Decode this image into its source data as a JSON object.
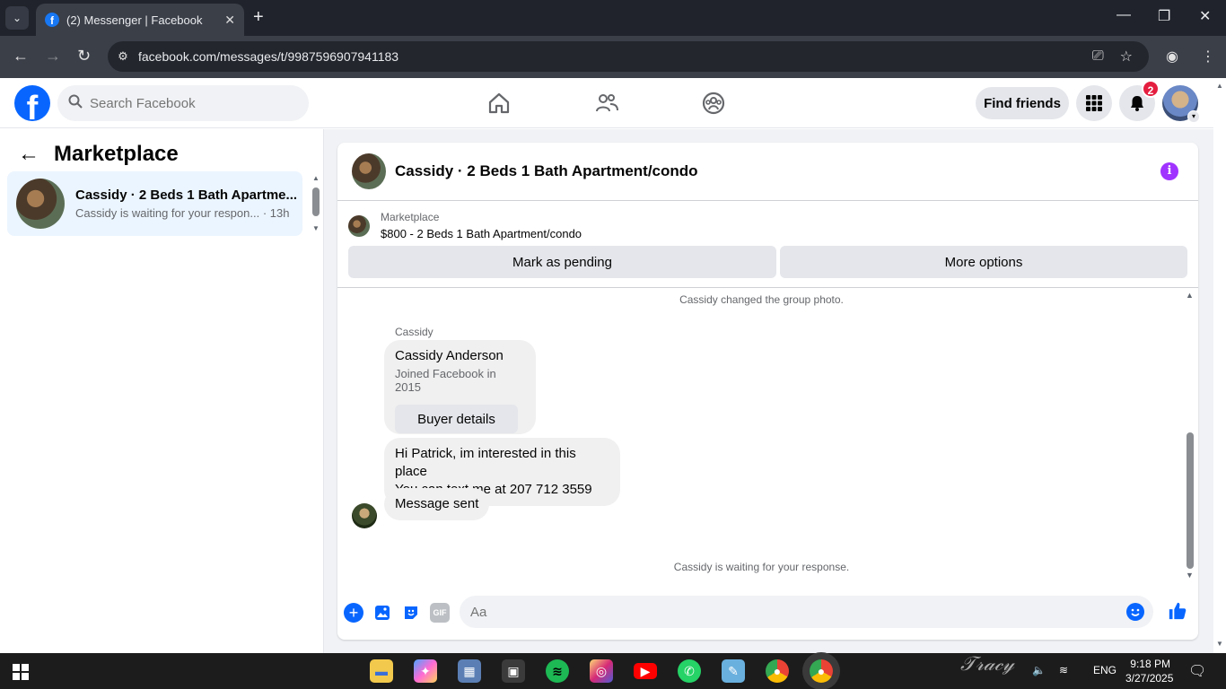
{
  "browser": {
    "tab_title": "(2) Messenger | Facebook",
    "url": "facebook.com/messages/t/9987596907941183"
  },
  "header": {
    "search_placeholder": "Search Facebook",
    "find_friends_label": "Find friends",
    "notifications_count": "2"
  },
  "sidebar": {
    "title": "Marketplace",
    "conversations": [
      {
        "title": "Cassidy · 2 Beds 1 Bath Apartme...",
        "preview": "Cassidy is waiting for your respon...",
        "time": "· 13h"
      }
    ]
  },
  "chat": {
    "title": "Cassidy · 2 Beds 1 Bath Apartment/condo",
    "listing_label": "Marketplace",
    "listing_price_title": "$800 - 2 Beds 1 Bath Apartment/condo",
    "mark_pending_label": "Mark as pending",
    "more_options_label": "More options",
    "system_group_photo": "Cassidy changed the group photo.",
    "sender_name": "Cassidy",
    "profile_card": {
      "name": "Cassidy Anderson",
      "joined": "Joined Facebook in 2015",
      "button_label": "Buyer details"
    },
    "messages": [
      "Hi Patrick, im interested in this place",
      "You can text me at 207 712 3559",
      "Message sent"
    ],
    "system_waiting": "Cassidy is waiting for your response.",
    "composer_placeholder": "Aa",
    "gif_label": "GIF"
  },
  "taskbar": {
    "time": "9:18 PM",
    "date": "3/27/2025",
    "language": "ENG"
  },
  "colors": {
    "facebook_blue": "#0866ff",
    "selected_conversation": "#ebf5ff",
    "bubble_gray": "#f0f0f0",
    "badge_red": "#e41e3f",
    "info_purple": "#a033ff"
  }
}
